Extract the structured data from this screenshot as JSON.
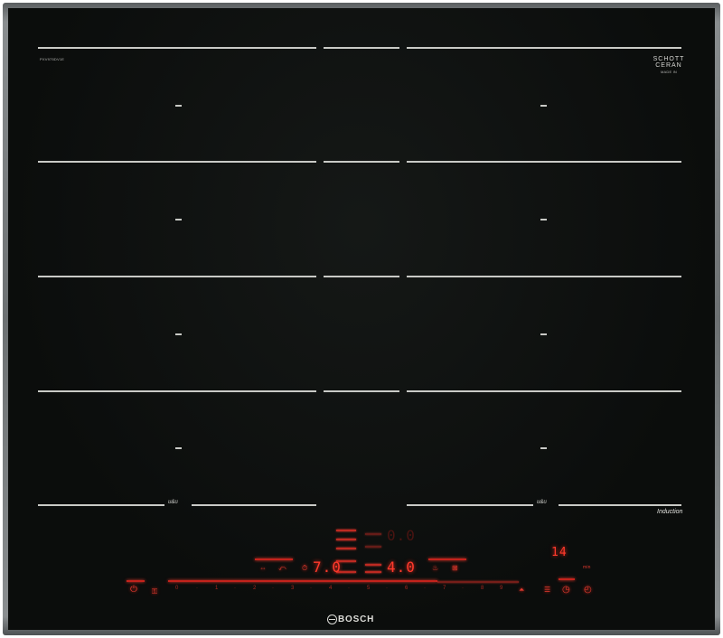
{
  "brand": {
    "name": "BOSCH"
  },
  "glass_brand": {
    "line1": "SCHOTT",
    "line2": "CERAN",
    "small": "MADE IN"
  },
  "model_code_left": "PXV975DV1E",
  "induction_label": "Induction",
  "flex_left": "ʊ&ʊ",
  "flex_right": "ʊ&ʊ",
  "displays": {
    "top_power": "0.0",
    "left_power": "7.0",
    "right_power": "4.0",
    "timer": "14",
    "timer_unit": "min"
  },
  "power_scale": {
    "labels": [
      "0",
      "1",
      "2",
      "3",
      "4",
      "5",
      "6",
      "7",
      "8",
      "9",
      "P"
    ]
  },
  "icons": {
    "power": "power-icon",
    "child_lock": "child-lock-icon",
    "frying_sensor": "frying-sensor-icon",
    "move_mode": "move-mode-icon",
    "timer": "timer-icon",
    "timer_clock": "clock-icon",
    "menu": "menu-icon",
    "boost": "boost-icon",
    "keep_warm": "keep-warm-icon",
    "pot": "pot-icon"
  },
  "colors": {
    "glass": "#0b0d0c",
    "led_red": "#e0382e",
    "markings": "#c9cac6"
  }
}
